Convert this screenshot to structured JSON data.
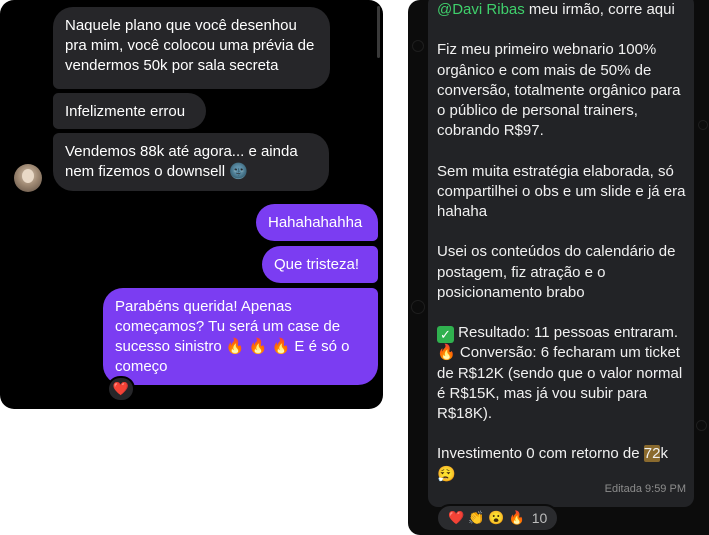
{
  "left_chat": {
    "messages": [
      {
        "direction": "incoming",
        "text": "Naquele plano que você desenhou pra mim, você colocou uma prévia de vendermos 50k por sala secreta"
      },
      {
        "direction": "incoming",
        "text": "Infelizmente errou"
      },
      {
        "direction": "incoming",
        "text": "Vendemos 88k até agora... e ainda nem fizemos o downsell 🌚"
      },
      {
        "direction": "outgoing",
        "text": "Hahahahahha"
      },
      {
        "direction": "outgoing",
        "text": "Que tristeza!"
      },
      {
        "direction": "outgoing",
        "text": "Parabéns querida! Apenas começamos? Tu será um case de sucesso sinistro 🔥 🔥 🔥  E é só o começo"
      }
    ],
    "reaction": "❤️",
    "colors": {
      "incoming": "#262629",
      "outgoing": "#7b3df2",
      "background": "#000000"
    }
  },
  "right_chat": {
    "mention": "@Davi Ribas",
    "line1_rest": " meu irmão, corre aqui",
    "para1": "Fiz meu primeiro webnario 100% orgânico e com mais de 50% de conversão, totalmente orgânico para o público de personal trainers, cobrando R$97.",
    "para2": "Sem muita estratégia elaborada, só compartilhei o obs e um slide e já era hahaha",
    "para3": "Usei os conteúdos do calendário de postagem, fiz atração e o posicionamento brabo",
    "result_icon": "✓",
    "result_text": " Resultado: 11 pessoas entraram.",
    "conversion_icon": "🔥",
    "conversion_text": " Conversão: 6 fecharam um ticket de R$12K (sendo que o valor normal é R$15K, mas já vou subir para R$18K).",
    "investment_pre": "Investimento 0 com retorno de ",
    "investment_highlight": "72",
    "investment_post": "k",
    "investment_emoji": "😮‍💨",
    "meta": "Editada 9:59 PM",
    "reactions": [
      "❤️",
      "👏",
      "😮",
      "🔥"
    ],
    "reaction_count": "10",
    "colors": {
      "bubble": "#222326",
      "mention": "#3fd06b",
      "background": "#0c0c0c"
    }
  }
}
